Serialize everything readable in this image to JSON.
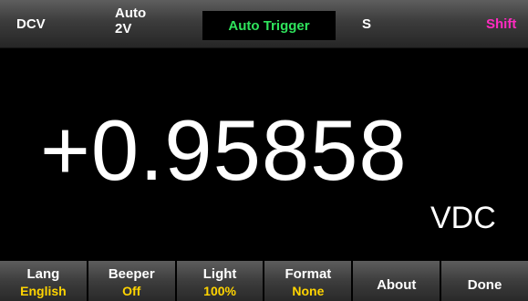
{
  "status_bar": {
    "mode": "DCV",
    "range_mode": "Auto",
    "range_value": "2V",
    "trigger": "Auto Trigger",
    "speed": "S",
    "shift": "Shift"
  },
  "display": {
    "reading": "+0.95858",
    "unit": "VDC"
  },
  "softkeys": [
    {
      "label": "Lang",
      "value": "English"
    },
    {
      "label": "Beeper",
      "value": "Off"
    },
    {
      "label": "Light",
      "value": "100%"
    },
    {
      "label": "Format",
      "value": "None"
    },
    {
      "label": "About"
    },
    {
      "label": "Done"
    }
  ],
  "colors": {
    "trigger_text": "#2fe35c",
    "shift_text": "#ff2ac0",
    "softkey_value": "#ffd400",
    "background": "#000000"
  }
}
